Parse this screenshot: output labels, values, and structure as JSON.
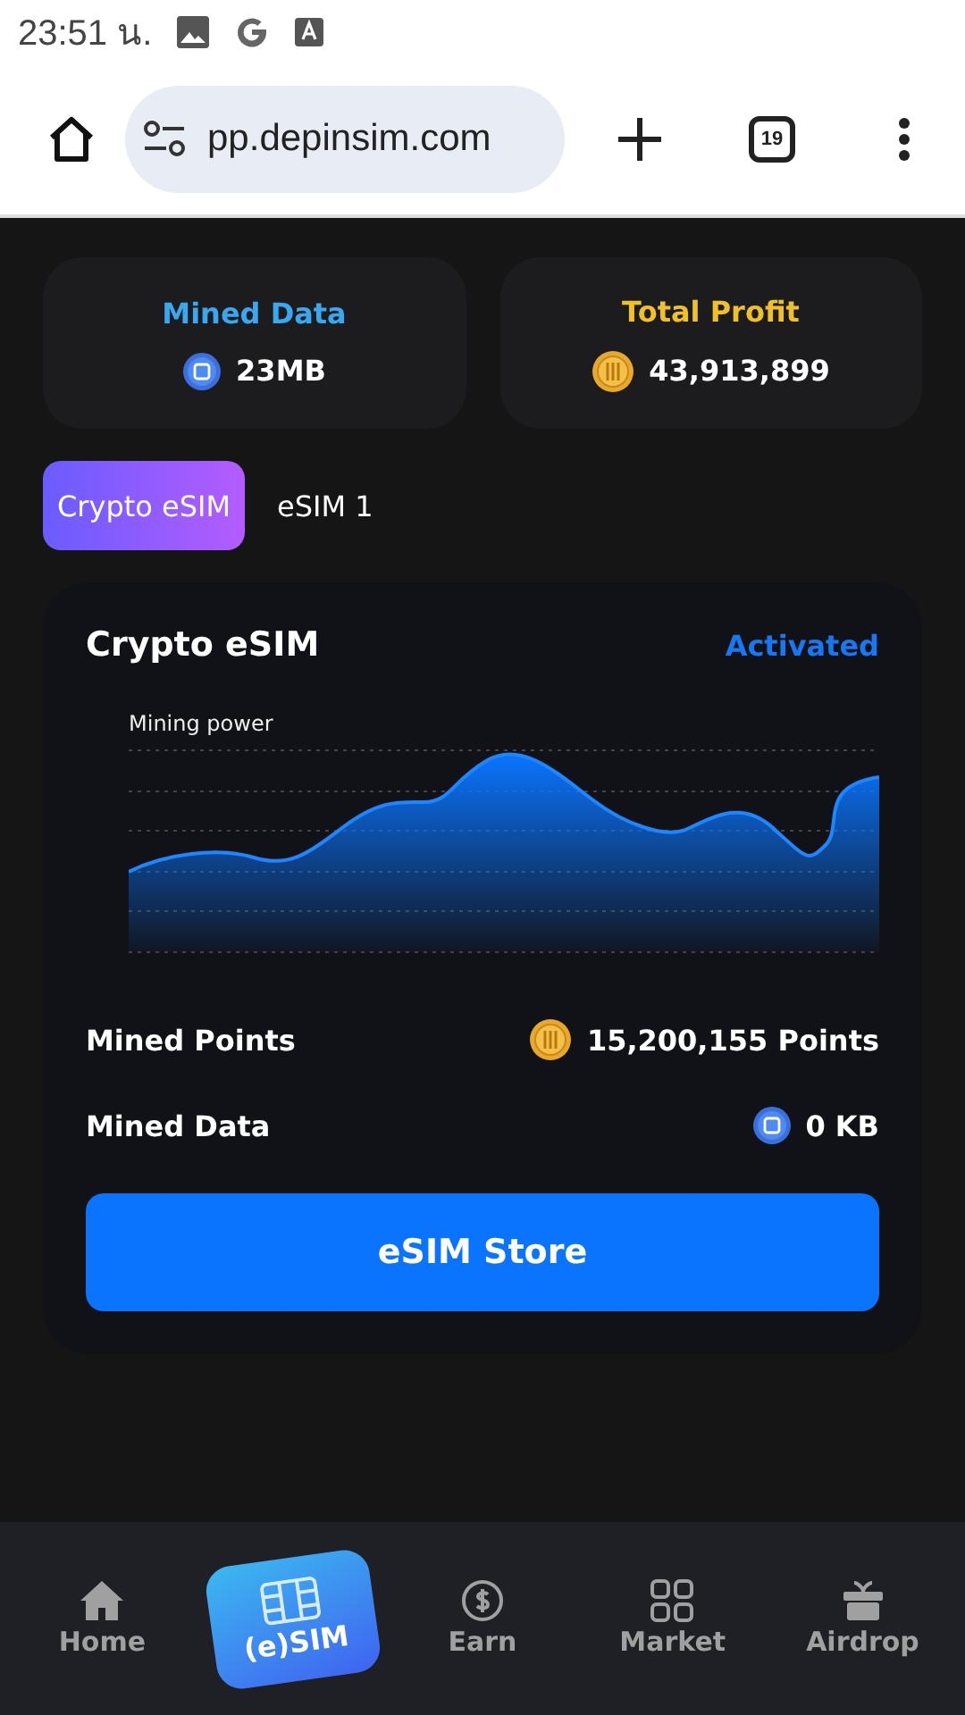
{
  "status_bar": {
    "time": "23:51 น."
  },
  "browser": {
    "url": "pp.depinsim.com",
    "tab_count": "19"
  },
  "stats": [
    {
      "kind": "data",
      "label": "Mined Data",
      "value": "23MB"
    },
    {
      "kind": "coin",
      "label": "Total Profit",
      "value": "43,913,899"
    }
  ],
  "sim_tabs": [
    {
      "label": "Crypto eSIM",
      "selected": true
    },
    {
      "label": "eSIM 1",
      "selected": false
    }
  ],
  "card": {
    "title": "Crypto eSIM",
    "status": "Activated",
    "chart_label": "Mining power",
    "rows": [
      {
        "kind": "coin",
        "label": "Mined Points",
        "value": "15,200,155 Points"
      },
      {
        "kind": "data",
        "label": "Mined Data",
        "value": "0 KB"
      }
    ],
    "button": "eSIM Store"
  },
  "nav": [
    {
      "kind": "home",
      "label": "Home",
      "selected": false
    },
    {
      "kind": "sim",
      "label": "(e)SIM",
      "selected": true
    },
    {
      "kind": "earn",
      "label": "Earn",
      "selected": false
    },
    {
      "kind": "market",
      "label": "Market",
      "selected": false
    },
    {
      "kind": "airdrop",
      "label": "Airdrop",
      "selected": false
    }
  ]
}
